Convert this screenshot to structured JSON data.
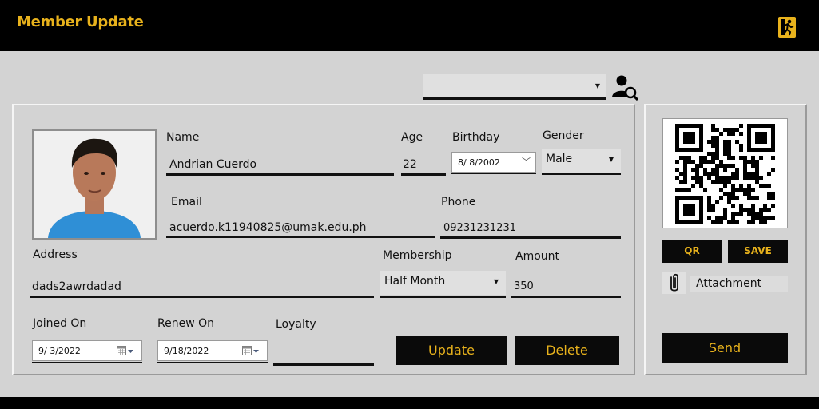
{
  "window": {
    "title": "Member Update",
    "exit_icon": "exit-run-icon"
  },
  "search": {
    "selected": "",
    "icon": "user-search-icon"
  },
  "member": {
    "name_label": "Name",
    "name_value": "Andrian Cuerdo",
    "age_label": "Age",
    "age_value": "22",
    "birthday_label": "Birthday",
    "birthday_value": "8/ 8/2002",
    "gender_label": "Gender",
    "gender_value": "Male",
    "email_label": "Email",
    "email_value": "acuerdo.k11940825@umak.edu.ph",
    "phone_label": "Phone",
    "phone_value": "09231231231",
    "address_label": "Address",
    "address_value": "dads2awrdadad",
    "membership_label": "Membership",
    "membership_value": "Half Month",
    "amount_label": "Amount",
    "amount_value": "350",
    "joined_label": "Joined On",
    "joined_value": "9/ 3/2022",
    "renew_label": "Renew On",
    "renew_value": "9/18/2022",
    "loyalty_label": "Loyalty",
    "loyalty_value": ""
  },
  "actions": {
    "update_label": "Update",
    "delete_label": "Delete"
  },
  "side": {
    "qr_label": "QR",
    "save_label": "SAVE",
    "attachment_label": "Attachment",
    "send_label": "Send"
  },
  "colors": {
    "accent": "#E8B21C",
    "background": "#D3D3D3",
    "titlebar": "#000000"
  }
}
